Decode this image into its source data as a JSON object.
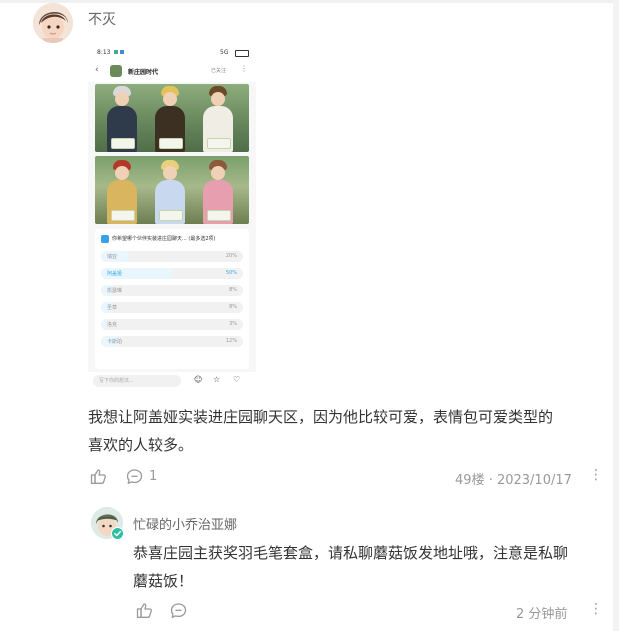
{
  "comment": {
    "author": "不灭",
    "text_line1": "我想让阿盖娅实装进庄园聊天区，因为他比较可爱，表情包可爱类型的",
    "text_line2": "喜欢的人较多。",
    "reply_count": "1",
    "floor": "49楼",
    "date": "2023/10/17",
    "dot": "·"
  },
  "screenshot": {
    "status_time": "8:13",
    "status_right": "5G",
    "group_title": "新庄园时代",
    "follow_label": "已关注",
    "poll_title": "你希望哪个伙伴实装进庄园聊天...",
    "poll_note": "(最多选2项)",
    "options": [
      {
        "label": "瑞亚",
        "percent": "20%",
        "selected": false
      },
      {
        "label": "阿盖娅",
        "percent": "50%",
        "selected": true
      },
      {
        "label": "凯瑟琳",
        "percent": "8%",
        "selected": false
      },
      {
        "label": "圣草",
        "percent": "8%",
        "selected": false
      },
      {
        "label": "洛克",
        "percent": "3%",
        "selected": false
      },
      {
        "label": "卡斯珀",
        "percent": "12%",
        "selected": false
      }
    ],
    "input_placeholder": "写下你的想法..."
  },
  "reply": {
    "author": "忙碌的小乔治亚娜",
    "text_line1": "恭喜庄园主获奖羽毛笔套盒，请私聊蘑菇饭发地址哦，注意是私聊",
    "text_line2": "蘑菇饭！",
    "time": "2 分钟前"
  },
  "icons": [
    "like-icon",
    "reply-icon",
    "more-icon",
    "verified-badge-icon"
  ],
  "colors": {
    "accent": "#37a8e8",
    "muted": "#999999",
    "badge": "#2fbfa0"
  }
}
